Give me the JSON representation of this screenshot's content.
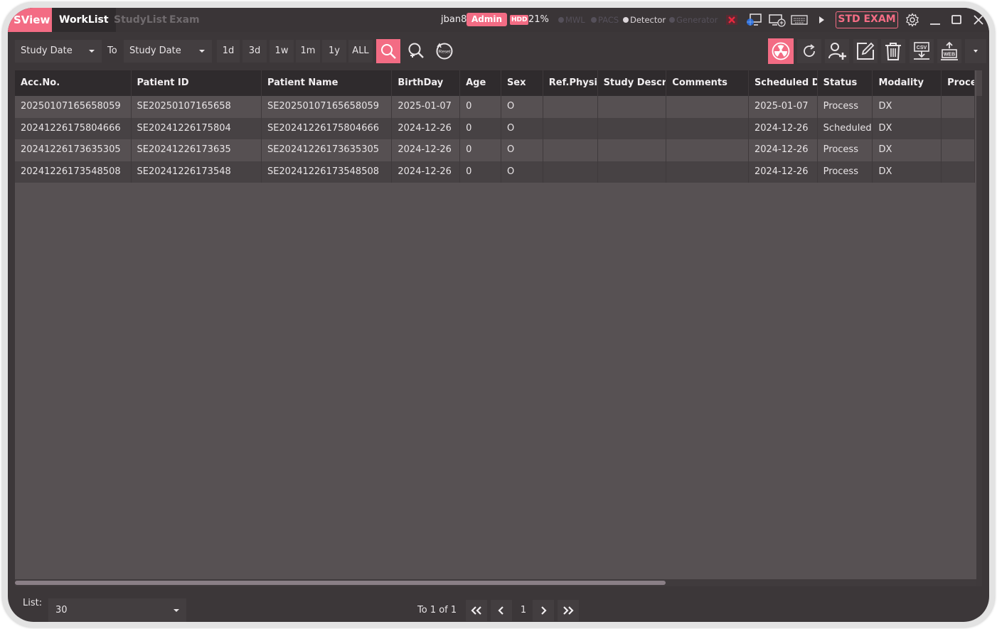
{
  "titlebar": {
    "app_name": "SView",
    "tabs": [
      {
        "label": "WorkList",
        "active": true
      },
      {
        "label": "StudyList",
        "active": false
      },
      {
        "label": "Exam",
        "active": false
      }
    ],
    "user": "jban8",
    "role_badge": "Admin",
    "hdd_label": "HDD",
    "hdd_usage": "21%",
    "status_indicators": [
      {
        "label": "MWL",
        "active": false
      },
      {
        "label": "PACS",
        "active": false
      },
      {
        "label": "Detector",
        "active": true
      },
      {
        "label": "Generator",
        "active": false
      }
    ],
    "icons": [
      "disconnected-x-icon",
      "network-monitor-icon",
      "remote-desktop-icon",
      "keyboard-icon",
      "play-icon"
    ],
    "mode_button": "STD EXAM",
    "window_controls": [
      "settings-icon",
      "minimize-icon",
      "maximize-icon",
      "close-icon"
    ]
  },
  "toolbar": {
    "date_from": "Study Date",
    "to_label": "To",
    "date_to": "Study Date",
    "ranges": [
      "1d",
      "3d",
      "1w",
      "1m",
      "1y",
      "ALL"
    ],
    "search_icons": [
      "search-icon",
      "advanced-search-icon",
      "reset-icon"
    ],
    "reset_text": "Reset",
    "action_icons": [
      "radiation-icon",
      "refresh-icon",
      "add-patient-icon",
      "edit-icon",
      "delete-icon",
      "csv-export-icon",
      "web-upload-icon",
      "more-dropdown-icon"
    ],
    "accent_color": "#f36c84"
  },
  "table": {
    "columns": [
      "Acc.No.",
      "Patient ID",
      "Patient Name",
      "BirthDay",
      "Age",
      "Sex",
      "Ref.Physician",
      "Study Description",
      "Comments",
      "Scheduled Date",
      "Status",
      "Modality",
      "Procedure"
    ],
    "rows": [
      [
        "20250107165658059",
        "SE20250107165658",
        "SE20250107165658059",
        "2025-01-07",
        "0",
        "O",
        "",
        "",
        "",
        "2025-01-07",
        "Process",
        "DX",
        ""
      ],
      [
        "20241226175804666",
        "SE20241226175804",
        "SE20241226175804666",
        "2024-12-26",
        "0",
        "O",
        "",
        "",
        "",
        "2024-12-26",
        "Scheduled",
        "DX",
        ""
      ],
      [
        "20241226173635305",
        "SE20241226173635",
        "SE20241226173635305",
        "2024-12-26",
        "0",
        "O",
        "",
        "",
        "",
        "2024-12-26",
        "Process",
        "DX",
        ""
      ],
      [
        "20241226173548508",
        "SE20241226173548",
        "SE20241226173548508",
        "2024-12-26",
        "0",
        "O",
        "",
        "",
        "",
        "2024-12-26",
        "Process",
        "DX",
        ""
      ]
    ]
  },
  "footer": {
    "list_label": "List:",
    "list_size": "30",
    "page_info": "To 1 of 1",
    "current_page": "1"
  }
}
